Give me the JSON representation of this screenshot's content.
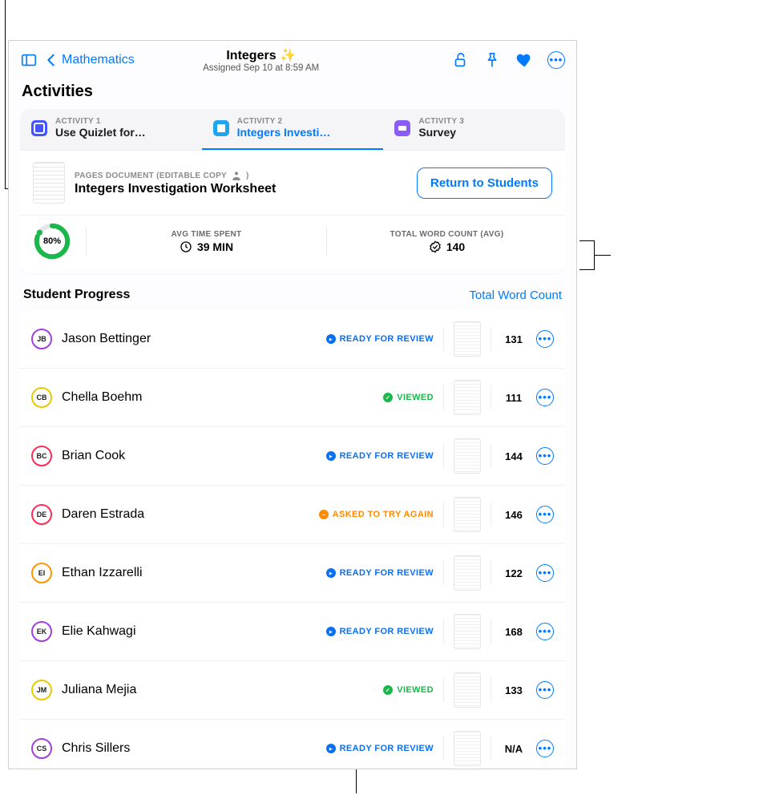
{
  "nav": {
    "back_label": "Mathematics",
    "title": "Integers ✨",
    "subtitle": "Assigned Sep 10 at 8:59 AM"
  },
  "section_title": "Activities",
  "tabs": [
    {
      "eyebrow": "ACTIVITY 1",
      "name": "Use Quizlet for…"
    },
    {
      "eyebrow": "ACTIVITY 2",
      "name": "Integers Investi…"
    },
    {
      "eyebrow": "ACTIVITY 3",
      "name": "Survey"
    }
  ],
  "doc": {
    "eyebrow": "PAGES DOCUMENT (EDITABLE COPY",
    "eyebrow_tail": ")",
    "title": "Integers Investigation Worksheet",
    "return_btn": "Return to Students"
  },
  "stats": {
    "pct": "80%",
    "time_label": "AVG TIME SPENT",
    "time_value": "39 MIN",
    "wc_label": "TOTAL WORD COUNT (AVG)",
    "wc_value": "140"
  },
  "progress": {
    "heading": "Student Progress",
    "metric_link": "Total Word Count"
  },
  "status_labels": {
    "ready": "READY FOR REVIEW",
    "viewed": "VIEWED",
    "try": "ASKED TO TRY AGAIN"
  },
  "students": [
    {
      "initials": "JB",
      "name": "Jason Bettinger",
      "status": "ready",
      "count": "131",
      "ring": "#a040e0"
    },
    {
      "initials": "CB",
      "name": "Chella Boehm",
      "status": "viewed",
      "count": "111",
      "ring": "#e8c900"
    },
    {
      "initials": "BC",
      "name": "Brian Cook",
      "status": "ready",
      "count": "144",
      "ring": "#ff2d55"
    },
    {
      "initials": "DE",
      "name": "Daren Estrada",
      "status": "try",
      "count": "146",
      "ring": "#ff2d55"
    },
    {
      "initials": "EI",
      "name": "Ethan Izzarelli",
      "status": "ready",
      "count": "122",
      "ring": "#ff9500"
    },
    {
      "initials": "EK",
      "name": "Elie Kahwagi",
      "status": "ready",
      "count": "168",
      "ring": "#a040e0"
    },
    {
      "initials": "JM",
      "name": "Juliana Mejia",
      "status": "viewed",
      "count": "133",
      "ring": "#e8c900"
    },
    {
      "initials": "CS",
      "name": "Chris Sillers",
      "status": "ready",
      "count": "N/A",
      "ring": "#a040e0"
    }
  ]
}
